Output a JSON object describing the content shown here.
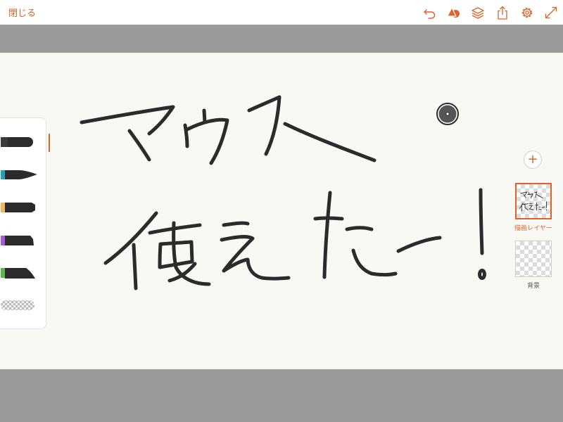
{
  "toolbar": {
    "close_label": "閉じる",
    "icons": [
      "undo-icon",
      "color-shape-icon",
      "layers-icon",
      "share-icon",
      "settings-icon",
      "fullscreen-icon"
    ]
  },
  "layers": {
    "items": [
      {
        "label": "描画レイヤー",
        "selected": true
      },
      {
        "label": "背景",
        "selected": false
      }
    ]
  },
  "brushes": [
    {
      "name": "marker",
      "accent": "#d9652b",
      "selected": true
    },
    {
      "name": "pen",
      "accent": "#1fa3b8",
      "selected": false
    },
    {
      "name": "pencil",
      "accent": "#f0b85a",
      "selected": false
    },
    {
      "name": "crayon",
      "accent": "#a45be0",
      "selected": false
    },
    {
      "name": "ink",
      "accent": "#56b848",
      "selected": false
    },
    {
      "name": "eraser",
      "accent": "#bcbcbc",
      "selected": false
    }
  ],
  "colors": {
    "accent": "#d9652b",
    "ink": "#2b2b2b",
    "canvas": "#f8f8f5",
    "background": "#9b9b9b"
  }
}
